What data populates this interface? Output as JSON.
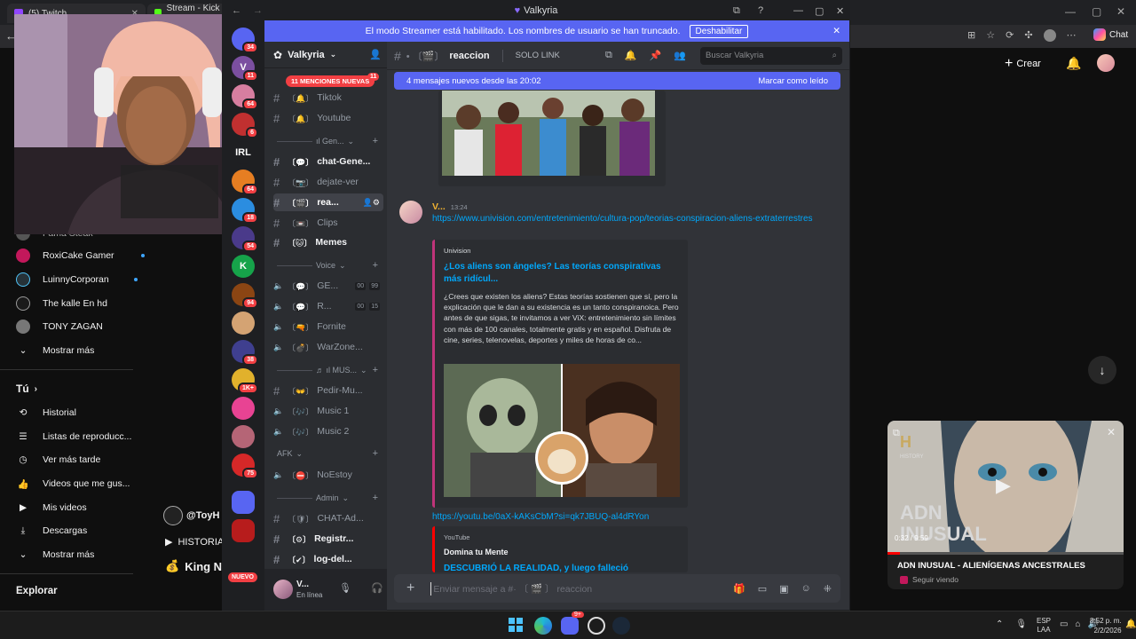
{
  "browser": {
    "tabs": [
      "(5) Twitch",
      "Stream - Kick Das"
    ],
    "chat_label": "Chat"
  },
  "youtube": {
    "partial_item": "Fama Steak",
    "subscriptions": [
      {
        "name": "RoxiCake Gamer",
        "live": true,
        "color": "#c2185b"
      },
      {
        "name": "LuinnyCorporan",
        "live": true,
        "color": "#263238"
      },
      {
        "name": "The kalle En hd",
        "live": false,
        "color": "#1a1a1a"
      },
      {
        "name": "TONY ZAGAN",
        "live": false,
        "color": "#777"
      }
    ],
    "show_more": "Mostrar más",
    "you_section": "Tú",
    "you_items": [
      "Historial",
      "Listas de reproducc...",
      "Ver más tarde",
      "Videos que me gus...",
      "Mis videos",
      "Descargas",
      "Mostrar más"
    ],
    "explore": "Explorar",
    "create_button": "Crear",
    "overlay_user": "@ToyH",
    "overlay_history": "HISTORIA",
    "overlay_king": "King Ne",
    "miniplayer": {
      "title": "ADN INUSUAL - ALIENÍGENAS ANCESTRALES",
      "status": "Seguir viendo",
      "time": "0:32 / 9:59",
      "thumb_text_1": "ADN",
      "thumb_text_2": "INUSUAL",
      "channel_logo": "H",
      "channel_name": "HISTORY",
      "progress": 0.053
    }
  },
  "discord": {
    "window_title": "Valkyria",
    "banner": {
      "text": "El modo Streamer está habilitado. Los nombres de usuario se han truncado.",
      "button": "Deshabilitar"
    },
    "server_name": "Valkyria",
    "mentions_pill": "11 MENCIONES NUEVAS",
    "mentions_count": "11",
    "servers": [
      {
        "badge": "34",
        "color": "#5865f2",
        "label": ""
      },
      {
        "badge": "11",
        "color": "#7b4fa0",
        "label": "V"
      },
      {
        "badge": "64",
        "color": "#d77ea0",
        "label": ""
      },
      {
        "badge": "6",
        "color": "#c03030",
        "label": ""
      },
      {
        "badge": "",
        "color": "#1e1f22",
        "label": "IRL"
      },
      {
        "badge": "64",
        "color": "#e67e22",
        "label": ""
      },
      {
        "badge": "18",
        "color": "#2b8de0",
        "label": ""
      },
      {
        "badge": "54",
        "color": "#4a3a8a",
        "label": ""
      },
      {
        "badge": "",
        "color": "#16a34a",
        "label": "K"
      },
      {
        "badge": "94",
        "color": "#8b4513",
        "label": ""
      },
      {
        "badge": "",
        "color": "#d4a373",
        "label": ""
      },
      {
        "badge": "38",
        "color": "#3f3f8f",
        "label": ""
      },
      {
        "badge": "1K+",
        "color": "#e1b12c",
        "label": ""
      },
      {
        "badge": "",
        "color": "#e84393",
        "label": ""
      },
      {
        "badge": "",
        "color": "#b56576",
        "label": ""
      },
      {
        "badge": "75",
        "color": "#d62828",
        "label": ""
      },
      {
        "badge": "",
        "color": "#5865f2",
        "label": ""
      },
      {
        "badge": "",
        "color": "#b71c1c",
        "label": ""
      }
    ],
    "new_label": "NUEVO",
    "channels": [
      {
        "type": "text",
        "name": "Tiktok",
        "emoji": "🔔",
        "bold": false
      },
      {
        "type": "text",
        "name": "Youtube",
        "emoji": "🔔",
        "bold": false
      },
      {
        "type": "category",
        "name": "ıl Gen..."
      },
      {
        "type": "text",
        "name": "chat-Gene...",
        "emoji": "💬",
        "bold": true
      },
      {
        "type": "text",
        "name": "dejate-ver",
        "emoji": "📷",
        "bold": false
      },
      {
        "type": "text",
        "name": "rea...",
        "emoji": "🎬",
        "bold": true,
        "selected": true
      },
      {
        "type": "text",
        "name": "Clips",
        "emoji": "📼",
        "bold": false
      },
      {
        "type": "text",
        "name": "Memes",
        "emoji": "🐱",
        "bold": true
      },
      {
        "type": "category",
        "name": "Voice"
      },
      {
        "type": "voice",
        "name": "GE...",
        "emoji": "💬",
        "count_a": "00",
        "count_b": "99"
      },
      {
        "type": "voice",
        "name": "R...",
        "emoji": "💬",
        "count_a": "00",
        "count_b": "15"
      },
      {
        "type": "voice",
        "name": "Fornite",
        "emoji": "🔫"
      },
      {
        "type": "voice",
        "name": "WarZone...",
        "emoji": "💣"
      },
      {
        "type": "category",
        "name": "♬ ıl MUS..."
      },
      {
        "type": "text",
        "name": "Pedir-Mu...",
        "emoji": "👐",
        "bold": false
      },
      {
        "type": "voice",
        "name": "Music 1",
        "emoji": "🎶"
      },
      {
        "type": "voice",
        "name": "Music 2",
        "emoji": "🎶"
      },
      {
        "type": "category",
        "name": "AFK"
      },
      {
        "type": "voice",
        "name": "NoEstoy",
        "emoji": "⛔"
      },
      {
        "type": "category",
        "name": "Admin"
      },
      {
        "type": "text",
        "name": "CHAT-Ad...",
        "emoji": "🛡",
        "bold": false
      },
      {
        "type": "text",
        "name": "Registr...",
        "emoji": "⚙",
        "bold": true
      },
      {
        "type": "text",
        "name": "log-del...",
        "emoji": "✔",
        "bold": true
      }
    ],
    "user": {
      "name": "V...",
      "status": "En línea"
    },
    "channel_header": {
      "name": "reaccion",
      "topic": "SOLO LINK",
      "search_placeholder": "Buscar Valkyria"
    },
    "new_messages": {
      "text": "4 mensajes nuevos desde las 20:02",
      "mark_read": "Marcar como leído"
    },
    "message": {
      "author": "V...",
      "time": "13:24",
      "link1": "https://www.univision.com/entretenimiento/cultura-pop/teorias-conspiracion-aliens-extraterrestres",
      "embed1": {
        "provider": "Univision",
        "title": "¿Los aliens son ángeles? Las teorías conspirativas más ridícul...",
        "description": "¿Crees que existen los aliens? Estas teorías sostienen que sí, pero la explicación que le dan a su existencia es un tanto conspiranoica. Pero antes de que sigas, te invitamos a ver ViX: entretenimiento sin límites con más de 100 canales, totalmente gratis y en español. Disfruta de cine, series, telenovelas, deportes y miles de horas de co..."
      },
      "link2": "https://youtu.be/0aX-kAKsCbM?si=qk7JBUQ-al4dRYon",
      "embed2": {
        "provider": "YouTube",
        "author": "Domina tu Mente",
        "title": "DESCUBRIÓ LA REALIDAD, y luego falleció"
      }
    },
    "input_placeholder": "Enviar mensaje a #· 〔 🎬 〕 reaccion"
  },
  "taskbar": {
    "lang_1": "ESP",
    "lang_2": "LAA",
    "time": "8:52 p. m.",
    "date": "2/2/2026",
    "discord_badge": "9+"
  }
}
